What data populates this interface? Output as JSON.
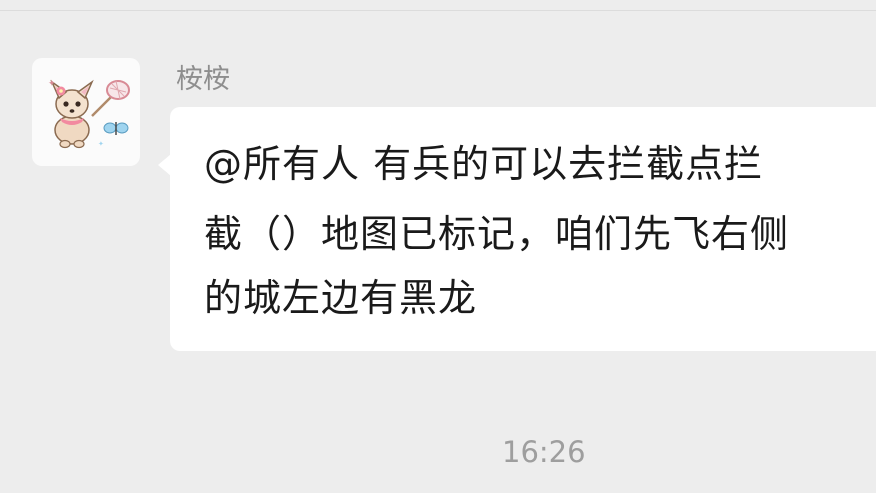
{
  "chat": {
    "sender_name": "桉桉",
    "message_lines": [
      "@所有人  有兵的可以去拦截点拦",
      "截（）地图已标记，咱们先飞右侧",
      "的城左边有黑龙"
    ],
    "timestamp": "16:26"
  },
  "colors": {
    "background": "#ededed",
    "bubble": "#ffffff",
    "name_text": "#8e8e8e",
    "message_text": "#1a1a1a",
    "timestamp_text": "#9e9e9e"
  },
  "icons": {
    "avatar": "chihuahua-with-butterfly-net-avatar"
  }
}
